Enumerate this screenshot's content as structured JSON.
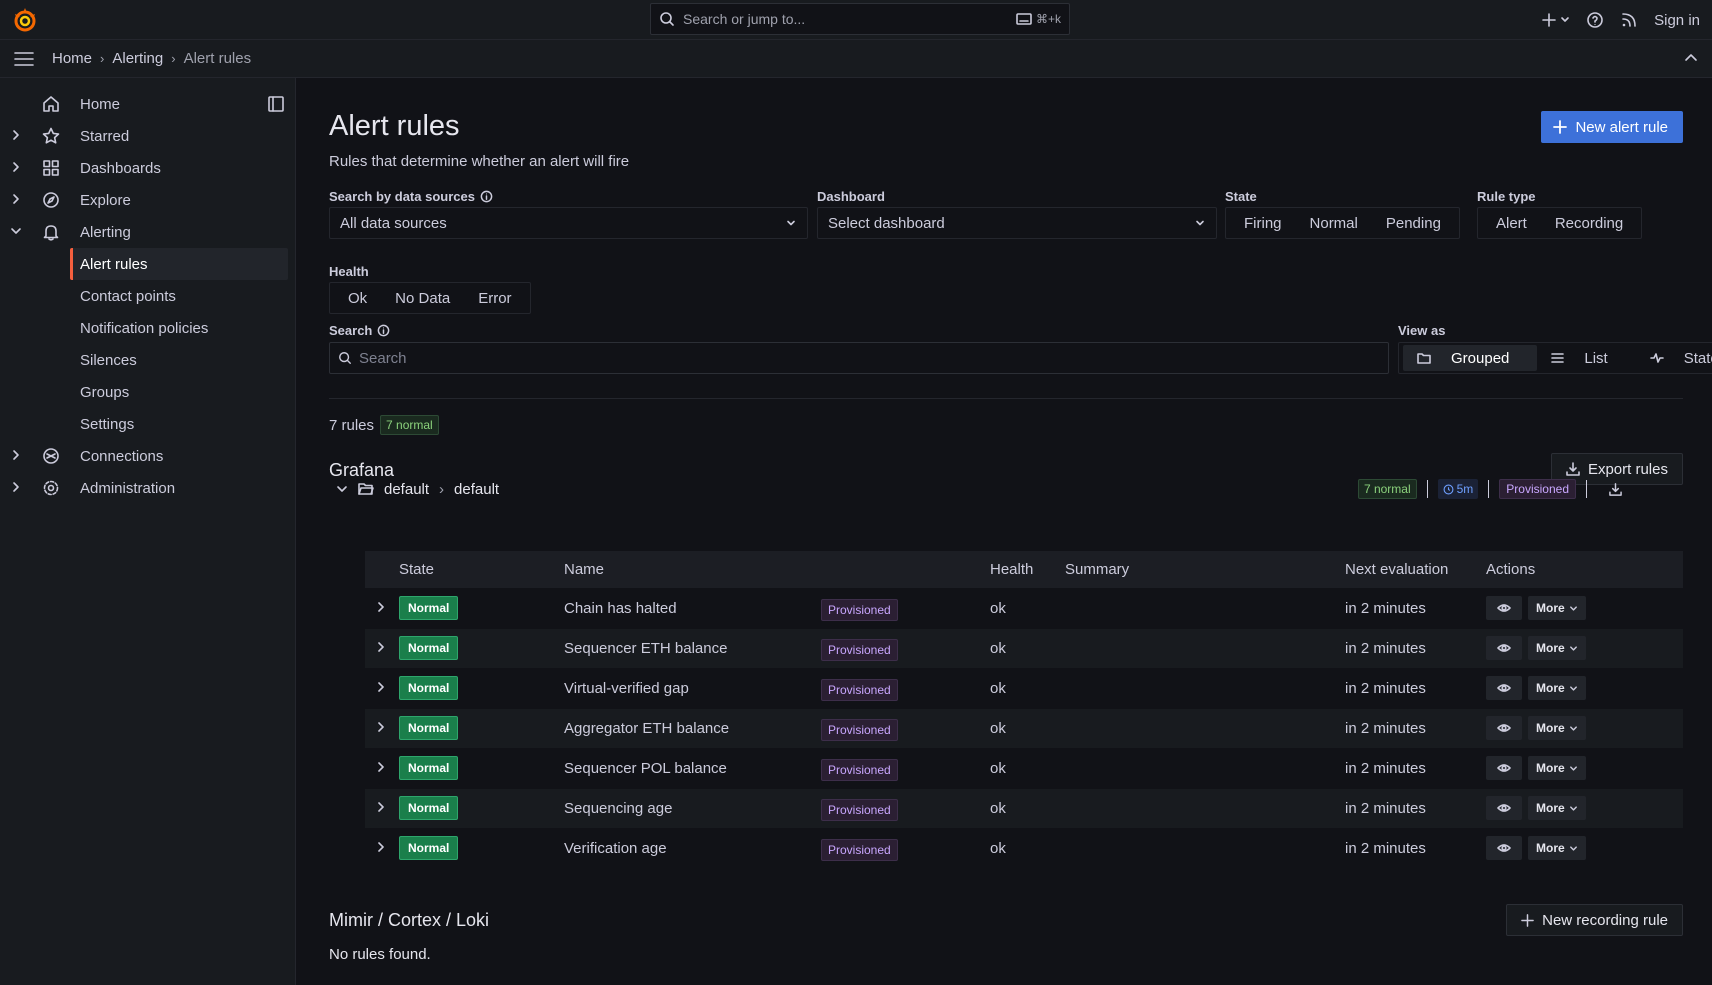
{
  "topbar": {
    "search_placeholder": "Search or jump to...",
    "shortcut": "⌘+k",
    "sign_in": "Sign in"
  },
  "breadcrumbs": [
    "Home",
    "Alerting",
    "Alert rules"
  ],
  "sidebar": {
    "items": [
      {
        "label": "Home",
        "icon": "home-icon"
      },
      {
        "label": "Starred",
        "icon": "star-icon"
      },
      {
        "label": "Dashboards",
        "icon": "dashboards-icon"
      },
      {
        "label": "Explore",
        "icon": "compass-icon"
      },
      {
        "label": "Alerting",
        "icon": "bell-icon"
      },
      {
        "label": "Connections",
        "icon": "connections-icon"
      },
      {
        "label": "Administration",
        "icon": "gear-icon"
      }
    ],
    "alerting_children": [
      "Alert rules",
      "Contact points",
      "Notification policies",
      "Silences",
      "Groups",
      "Settings"
    ]
  },
  "page": {
    "title": "Alert rules",
    "subtitle": "Rules that determine whether an alert will fire",
    "new_rule_button": "New alert rule"
  },
  "filters": {
    "datasource_label": "Search by data sources",
    "datasource_value": "All data sources",
    "dashboard_label": "Dashboard",
    "dashboard_value": "Select dashboard",
    "state_label": "State",
    "state_options": [
      "Firing",
      "Normal",
      "Pending"
    ],
    "ruletype_label": "Rule type",
    "ruletype_options": [
      "Alert",
      "Recording"
    ],
    "health_label": "Health",
    "health_options": [
      "Ok",
      "No Data",
      "Error"
    ],
    "search_label": "Search",
    "search_placeholder": "Search",
    "viewas_label": "View as",
    "viewas_options": [
      "Grouped",
      "List",
      "State"
    ],
    "viewas_selected": "Grouped"
  },
  "summary": {
    "rule_count": "7 rules",
    "normal_count": "7 normal"
  },
  "grafana_section": {
    "title": "Grafana",
    "export_button": "Export rules",
    "group": {
      "folder": "default",
      "name": "default",
      "normal_tag": "7 normal",
      "interval": "5m",
      "provisioned": "Provisioned"
    },
    "columns": [
      "State",
      "Name",
      "Health",
      "Summary",
      "Next evaluation",
      "Actions"
    ],
    "rows": [
      {
        "state": "Normal",
        "name": "Chain has halted",
        "tag": "Provisioned",
        "health": "ok",
        "summary": "",
        "next": "in 2 minutes",
        "more": "More"
      },
      {
        "state": "Normal",
        "name": "Sequencer ETH balance",
        "tag": "Provisioned",
        "health": "ok",
        "summary": "",
        "next": "in 2 minutes",
        "more": "More"
      },
      {
        "state": "Normal",
        "name": "Virtual-verified gap",
        "tag": "Provisioned",
        "health": "ok",
        "summary": "",
        "next": "in 2 minutes",
        "more": "More"
      },
      {
        "state": "Normal",
        "name": "Aggregator ETH balance",
        "tag": "Provisioned",
        "health": "ok",
        "summary": "",
        "next": "in 2 minutes",
        "more": "More"
      },
      {
        "state": "Normal",
        "name": "Sequencer POL balance",
        "tag": "Provisioned",
        "health": "ok",
        "summary": "",
        "next": "in 2 minutes",
        "more": "More"
      },
      {
        "state": "Normal",
        "name": "Sequencing age",
        "tag": "Provisioned",
        "health": "ok",
        "summary": "",
        "next": "in 2 minutes",
        "more": "More"
      },
      {
        "state": "Normal",
        "name": "Verification age",
        "tag": "Provisioned",
        "health": "ok",
        "summary": "",
        "next": "in 2 minutes",
        "more": "More"
      }
    ]
  },
  "mimir_section": {
    "title": "Mimir / Cortex / Loki",
    "new_recording_button": "New recording rule",
    "empty_text": "No rules found."
  },
  "colors": {
    "accent": "#3d71d9",
    "active_indicator": "#f55f3e",
    "normal_badge": "#1a7f4b",
    "provisioned_text": "#c9a7ff"
  }
}
